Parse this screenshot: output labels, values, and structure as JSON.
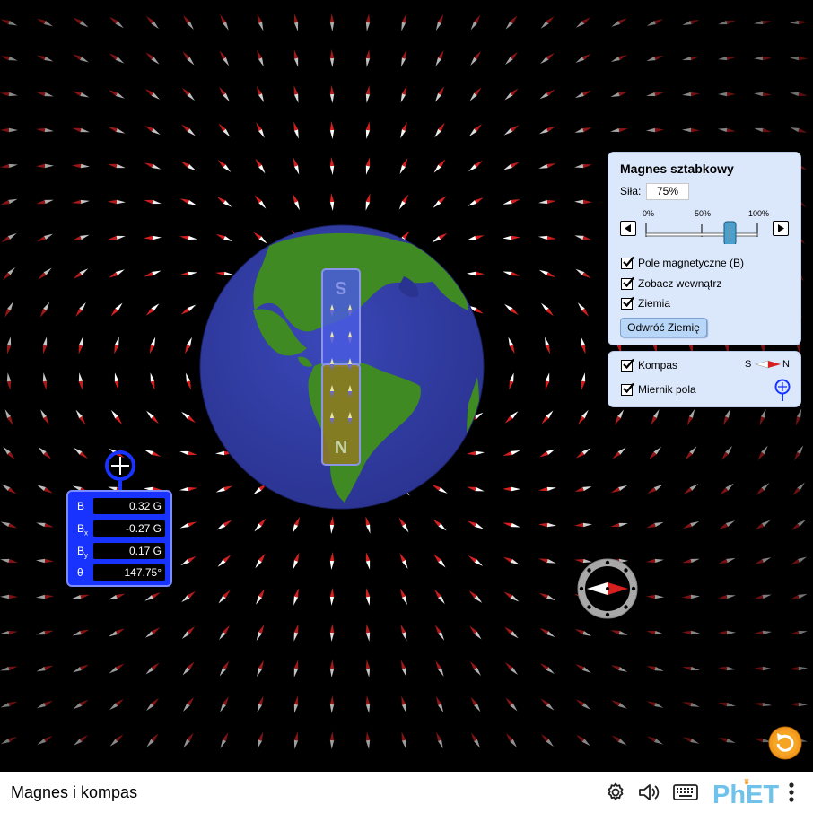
{
  "sim": {
    "colors": {
      "background": "#000000",
      "needle_north": "#d62020",
      "needle_south": "#ffffff"
    }
  },
  "earth": {
    "icon": "earth-globe"
  },
  "magnet": {
    "south_label": "S",
    "north_label": "N"
  },
  "bar_magnet_panel": {
    "title": "Magnes sztabkowy",
    "strength_label": "Siła:",
    "strength_value": "75%",
    "strength_percent": 75,
    "ticks": [
      "0%",
      "50%",
      "100%"
    ],
    "checkboxes": [
      {
        "label": "Pole magnetyczne (B)",
        "checked": true
      },
      {
        "label": "Zobacz wewnątrz",
        "checked": true
      },
      {
        "label": "Ziemia",
        "checked": true
      }
    ],
    "flip_button": "Odwróć Ziemię"
  },
  "tools_panel": {
    "compass_label": "Kompas",
    "compass_checked": true,
    "compass_icon_s": "S",
    "compass_icon_n": "N",
    "field_meter_label": "Miernik pola",
    "field_meter_checked": true
  },
  "field_meter": {
    "rows": [
      {
        "label": "B",
        "value": "0.32 G"
      },
      {
        "label": "Bx",
        "sub": "x",
        "value": "-0.27 G"
      },
      {
        "label": "By",
        "sub": "y",
        "value": "0.17 G"
      },
      {
        "label": "θ",
        "value": "147.75°"
      }
    ]
  },
  "navbar": {
    "title": "Magnes i kompas",
    "logo": "PhET",
    "icons": [
      "settings-icon",
      "sound-icon",
      "keyboard-icon",
      "phet-logo",
      "menu-icon"
    ]
  }
}
